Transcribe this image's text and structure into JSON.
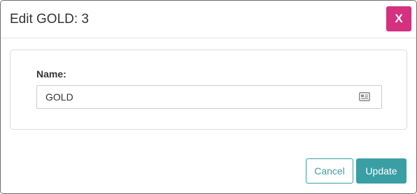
{
  "dialog": {
    "title": "Edit GOLD: 3",
    "close_label": "X"
  },
  "form": {
    "name_label": "Name:",
    "name_value": "GOLD",
    "name_icon": "id-card-icon"
  },
  "footer": {
    "cancel_label": "Cancel",
    "update_label": "Update"
  },
  "colors": {
    "close_button": "#d4317f",
    "primary": "#3a9ea5"
  }
}
